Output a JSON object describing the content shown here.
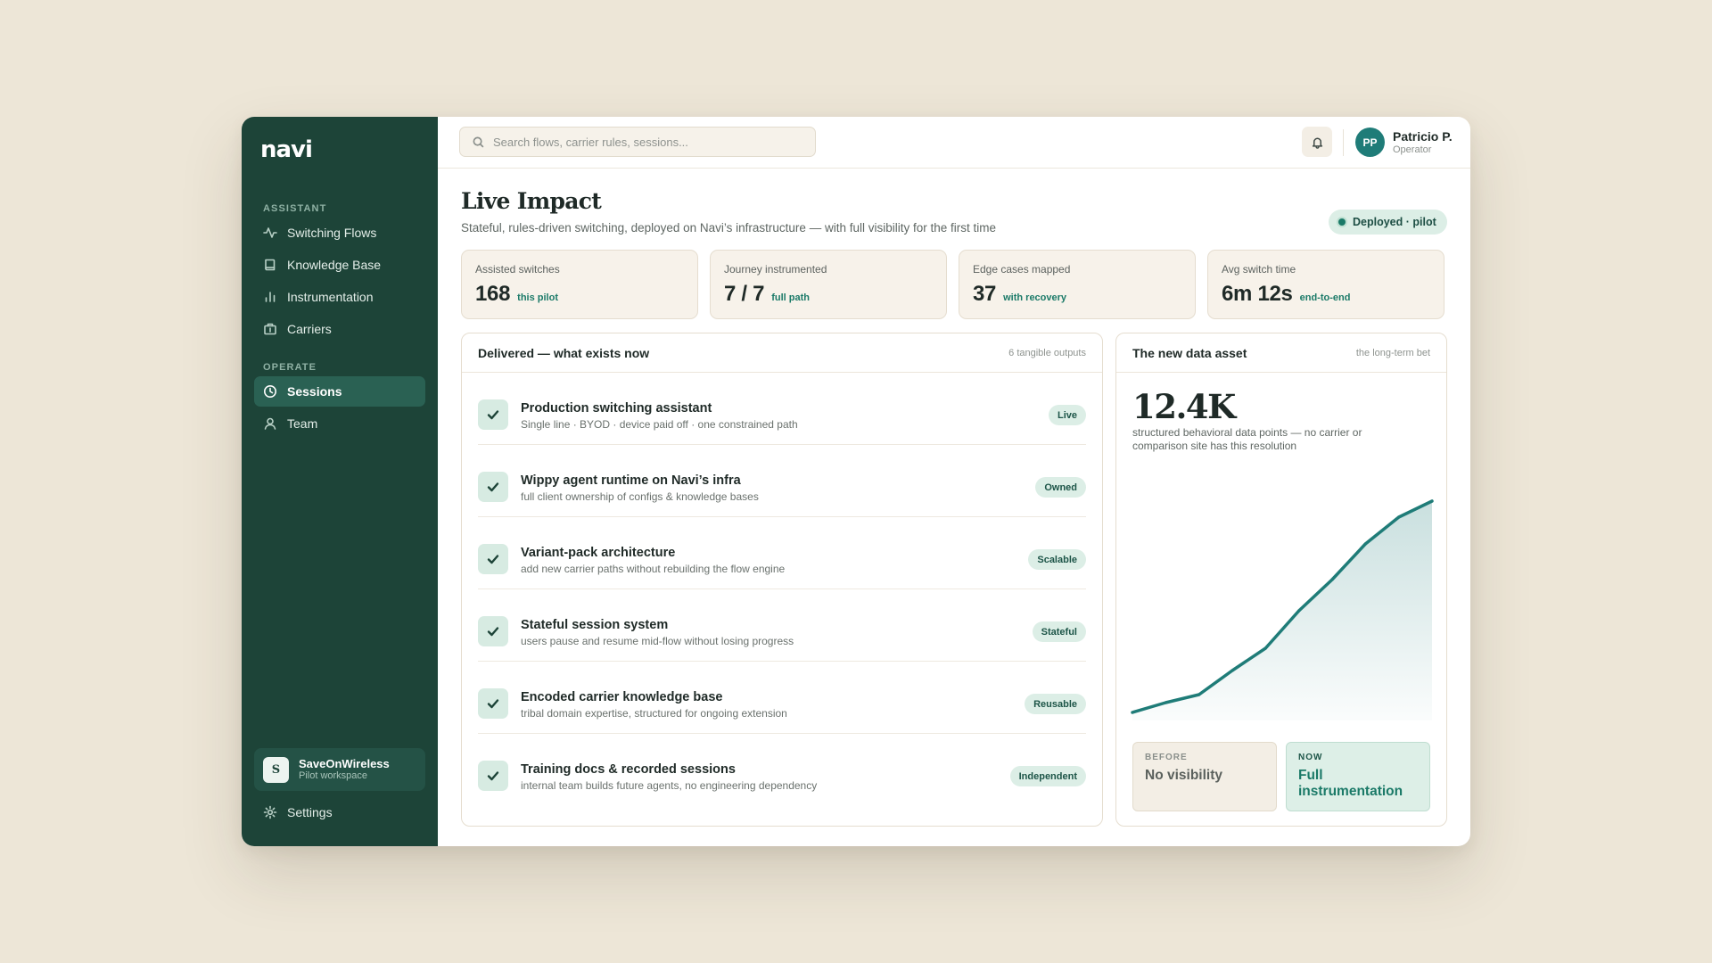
{
  "app": {
    "logo": "navi"
  },
  "sidebar": {
    "sections": [
      {
        "label": "ASSISTANT",
        "items": [
          {
            "label": "Switching Flows",
            "icon": "activity-icon"
          },
          {
            "label": "Knowledge Base",
            "icon": "book-icon"
          },
          {
            "label": "Instrumentation",
            "icon": "bar-chart-icon"
          },
          {
            "label": "Carriers",
            "icon": "building-icon"
          }
        ]
      },
      {
        "label": "OPERATE",
        "items": [
          {
            "label": "Sessions",
            "icon": "clock-icon",
            "active": true
          },
          {
            "label": "Team",
            "icon": "user-icon"
          }
        ]
      }
    ],
    "workspace": {
      "initial": "S",
      "name": "SaveOnWireless",
      "subtitle": "Pilot workspace"
    },
    "settings_label": "Settings"
  },
  "topbar": {
    "search_placeholder": "Search flows, carrier rules, sessions...",
    "user": {
      "initials": "PP",
      "name": "Patricio P.",
      "role": "Operator"
    }
  },
  "page": {
    "title": "Live Impact",
    "subtitle": "Stateful, rules-driven switching, deployed on Navi’s infrastructure — with full visibility for the first time",
    "status_pill": "Deployed · pilot"
  },
  "stats": [
    {
      "label": "Assisted switches",
      "value": "168",
      "note": "this pilot"
    },
    {
      "label": "Journey instrumented",
      "value": "7 / 7",
      "note": "full path"
    },
    {
      "label": "Edge cases mapped",
      "value": "37",
      "note": "with recovery"
    },
    {
      "label": "Avg switch time",
      "value": "6m 12s",
      "note": "end-to-end"
    }
  ],
  "delivered": {
    "title": "Delivered — what exists now",
    "meta": "6 tangible outputs",
    "items": [
      {
        "title": "Production switching assistant",
        "desc": "Single line · BYOD · device paid off · one constrained path",
        "badge": "Live"
      },
      {
        "title": "Wippy agent runtime on Navi’s infra",
        "desc": "full client ownership of configs & knowledge bases",
        "badge": "Owned"
      },
      {
        "title": "Variant-pack architecture",
        "desc": "add new carrier paths without rebuilding the flow engine",
        "badge": "Scalable"
      },
      {
        "title": "Stateful session system",
        "desc": "users pause and resume mid-flow without losing progress",
        "badge": "Stateful"
      },
      {
        "title": "Encoded carrier knowledge base",
        "desc": "tribal domain expertise, structured for ongoing extension",
        "badge": "Reusable"
      },
      {
        "title": "Training docs & recorded sessions",
        "desc": "internal team builds future agents, no engineering dependency",
        "badge": "Independent"
      }
    ]
  },
  "data_asset": {
    "title": "The new data asset",
    "meta": "the long-term bet",
    "big_number": "12.4K",
    "description": "structured behavioral data points — no carrier or comparison site has this resolution",
    "before": {
      "label": "BEFORE",
      "value": "No visibility"
    },
    "now": {
      "label": "NOW",
      "value": "Full instrumentation"
    },
    "accent": "#1F7C78"
  },
  "chart_data": {
    "type": "area",
    "title": "",
    "xlabel": "",
    "ylabel": "",
    "grid": false,
    "x": [
      0,
      1,
      2,
      3,
      4,
      5,
      6,
      7,
      8,
      9
    ],
    "values": [
      0.9,
      2.0,
      2.9,
      5.6,
      8.1,
      12.3,
      15.8,
      19.8,
      22.8,
      24.6
    ],
    "ylim": [
      0,
      27
    ]
  }
}
